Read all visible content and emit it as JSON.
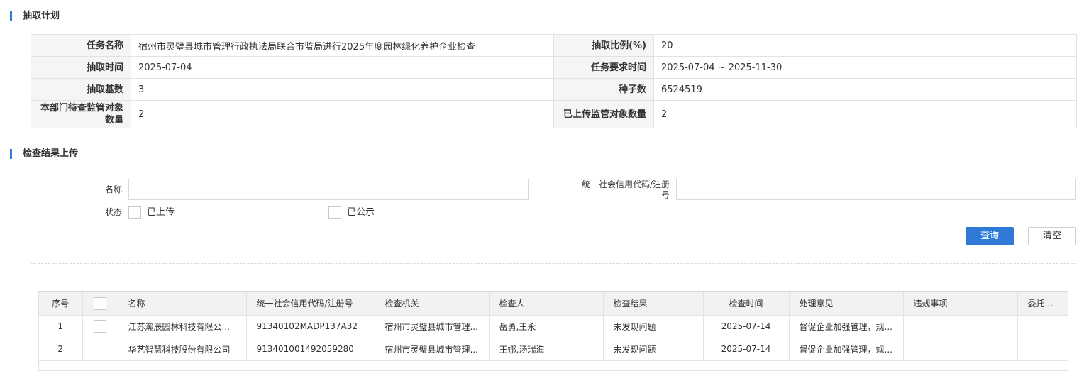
{
  "section_plan": {
    "title": "抽取计划"
  },
  "plan": {
    "task_name_label": "任务名称",
    "task_name": "宿州市灵璧县城市管理行政执法局联合市监局进行2025年度园林绿化养护企业检查",
    "ratio_label": "抽取比例(%)",
    "ratio": "20",
    "draw_time_label": "抽取时间",
    "draw_time": "2025-07-04",
    "required_time_label": "任务要求时间",
    "required_time": "2025-07-04 ~ 2025-11-30",
    "base_count_label": "抽取基数",
    "base_count": "3",
    "seed_label": "种子数",
    "seed": "6524519",
    "pending_label": "本部门待查监管对象数量",
    "pending": "2",
    "uploaded_label": "已上传监管对象数量",
    "uploaded": "2"
  },
  "section_upload": {
    "title": "检查结果上传"
  },
  "search": {
    "name_label": "名称",
    "name_value": "",
    "code_label": "统一社会信用代码/注册号",
    "code_value": "",
    "status_label": "状态",
    "status_uploaded": "已上传",
    "status_published": "已公示",
    "query_button": "查询",
    "clear_button": "清空"
  },
  "grid": {
    "columns": [
      "序号",
      "",
      "名称",
      "统一社会信用代码/注册号",
      "检查机关",
      "检查人",
      "检查结果",
      "检查时间",
      "处理意见",
      "违规事项",
      "委托部门"
    ],
    "rows": [
      [
        "1",
        "",
        "江苏瀚辰园林科技有限公...",
        "91340102MADP137A32",
        "宿州市灵璧县城市管理...",
        "岳勇,王永",
        "未发现问题",
        "2025-07-14",
        "督促企业加强管理，规...",
        "",
        ""
      ],
      [
        "2",
        "",
        "华艺智慧科技股份有限公司",
        "913401001492059280",
        "宿州市灵璧县城市管理...",
        "王娜,汤瑞海",
        "未发现问题",
        "2025-07-14",
        "督促企业加强管理，规...",
        "",
        ""
      ]
    ]
  },
  "colors": {
    "accent": "#2e7ad6",
    "label_bg": "#f5f5f5",
    "header_bg": "#f2f2f2"
  }
}
